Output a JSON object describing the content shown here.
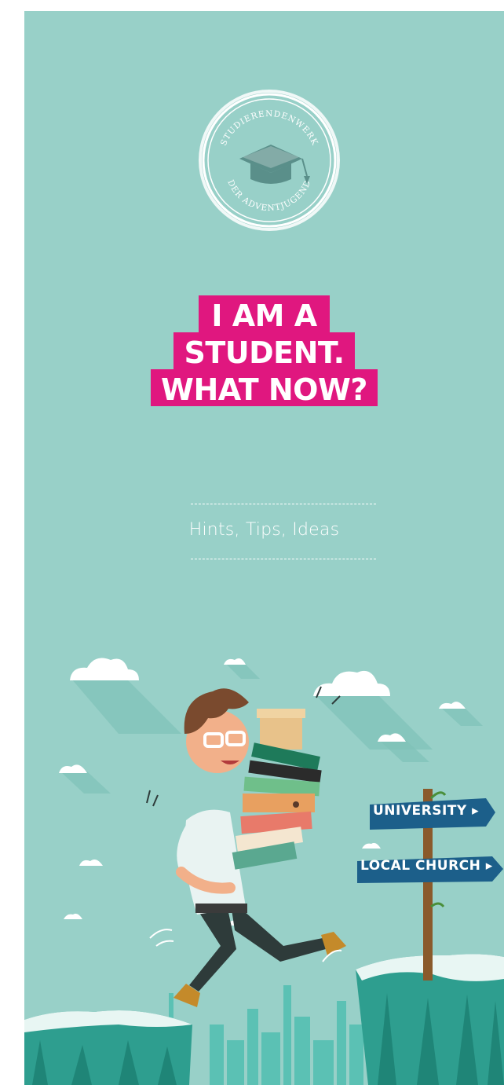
{
  "seal": {
    "top_text": "STUDIERENDENWERK",
    "bottom_text": "DER ADVENTJUGEND",
    "icon": "graduation-cap-icon"
  },
  "headline": {
    "line1": "I AM A",
    "line2": "STUDENT.",
    "line3": "WHAT NOW?"
  },
  "subtitle": "Hints, Tips, Ideas",
  "signpost": {
    "sign1": "UNIVERSITY",
    "sign2": "LOCAL CHURCH"
  },
  "colors": {
    "background": "#98d0c8",
    "accent": "#e0177f",
    "sign_blue": "#1c5f8a"
  }
}
